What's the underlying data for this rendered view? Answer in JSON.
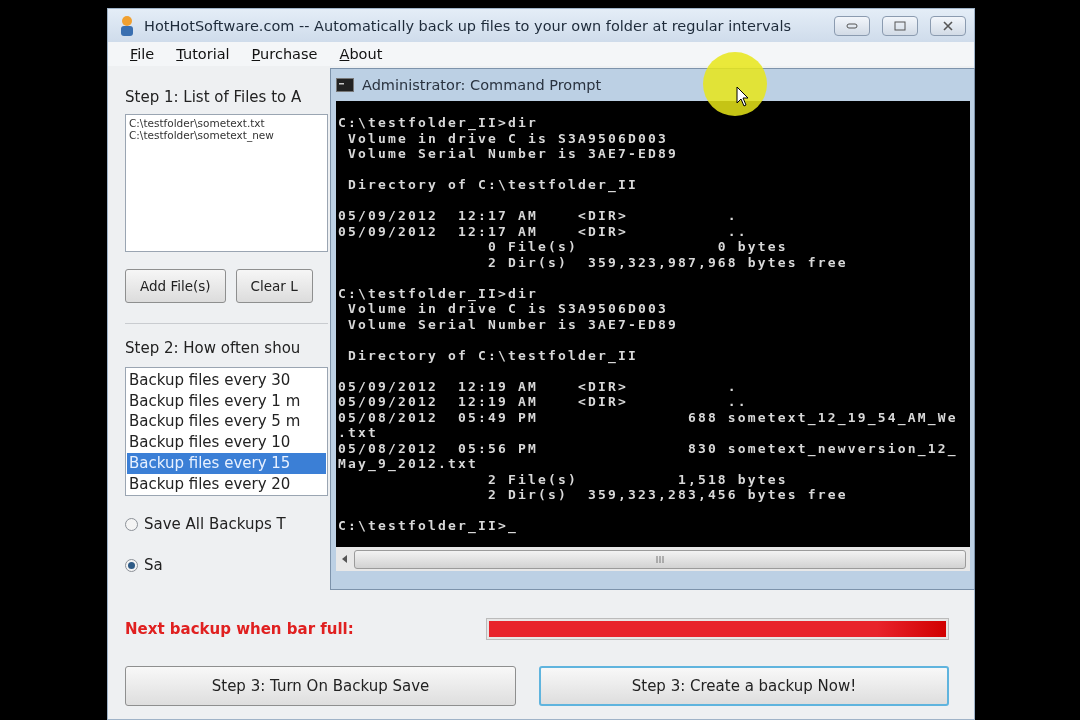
{
  "window": {
    "title": "HotHotSoftware.com -- Automatically back up files to your own folder at regular intervals"
  },
  "menu": [
    "File",
    "Tutorial",
    "Purchase",
    "About"
  ],
  "step1": {
    "label": "Step 1: List of Files to A",
    "files": [
      "C:\\testfolder\\sometext.txt",
      "C:\\testfolder\\sometext_new"
    ],
    "buttons": [
      "Add File(s)",
      "Clear L"
    ]
  },
  "step2": {
    "label": "Step 2: How often shou",
    "intervals": [
      {
        "label": "Backup files every 30",
        "selected": false
      },
      {
        "label": "Backup files every 1 m",
        "selected": false
      },
      {
        "label": "Backup files every 5 m",
        "selected": false
      },
      {
        "label": "Backup files every 10",
        "selected": false
      },
      {
        "label": "Backup files every 15",
        "selected": true
      },
      {
        "label": "Backup files every 20",
        "selected": false
      }
    ]
  },
  "save_options": [
    {
      "label": "Save All Backups T",
      "selected": false
    },
    {
      "label": "Sa",
      "selected": true
    }
  ],
  "progress": {
    "label": "Next backup when bar full:",
    "level": 1
  },
  "actions": [
    {
      "label": "Step 3: Turn On Backup Save",
      "focused": false
    },
    {
      "label": "Step 3: Create a backup Now!",
      "focused": true
    }
  ],
  "console": {
    "title": "Administrator: Command Prompt",
    "blocks": [
      [
        "C:\\testfolder_II>dir",
        " Volume in drive C is S3A9506D003",
        " Volume Serial Number is 3AE7-ED89"
      ],
      [
        " Directory of C:\\testfolder_II"
      ],
      [
        "05/09/2012  12:17 AM    <DIR>          .",
        "05/09/2012  12:17 AM    <DIR>          ..",
        "               0 File(s)              0 bytes",
        "               2 Dir(s)  359,323,987,968 bytes free"
      ],
      [
        "C:\\testfolder_II>dir",
        " Volume in drive C is S3A9506D003",
        " Volume Serial Number is 3AE7-ED89"
      ],
      [
        " Directory of C:\\testfolder_II"
      ],
      [
        "05/09/2012  12:19 AM    <DIR>          .",
        "05/09/2012  12:19 AM    <DIR>          ..",
        "05/08/2012  05:49 PM               688 sometext_12_19_54_AM_We",
        ".txt",
        "05/08/2012  05:56 PM               830 sometext_newversion_12_",
        "May_9_2012.txt",
        "               2 File(s)          1,518 bytes",
        "               2 Dir(s)  359,323,283,456 bytes free"
      ],
      [
        "C:\\testfolder_II>_"
      ]
    ]
  }
}
